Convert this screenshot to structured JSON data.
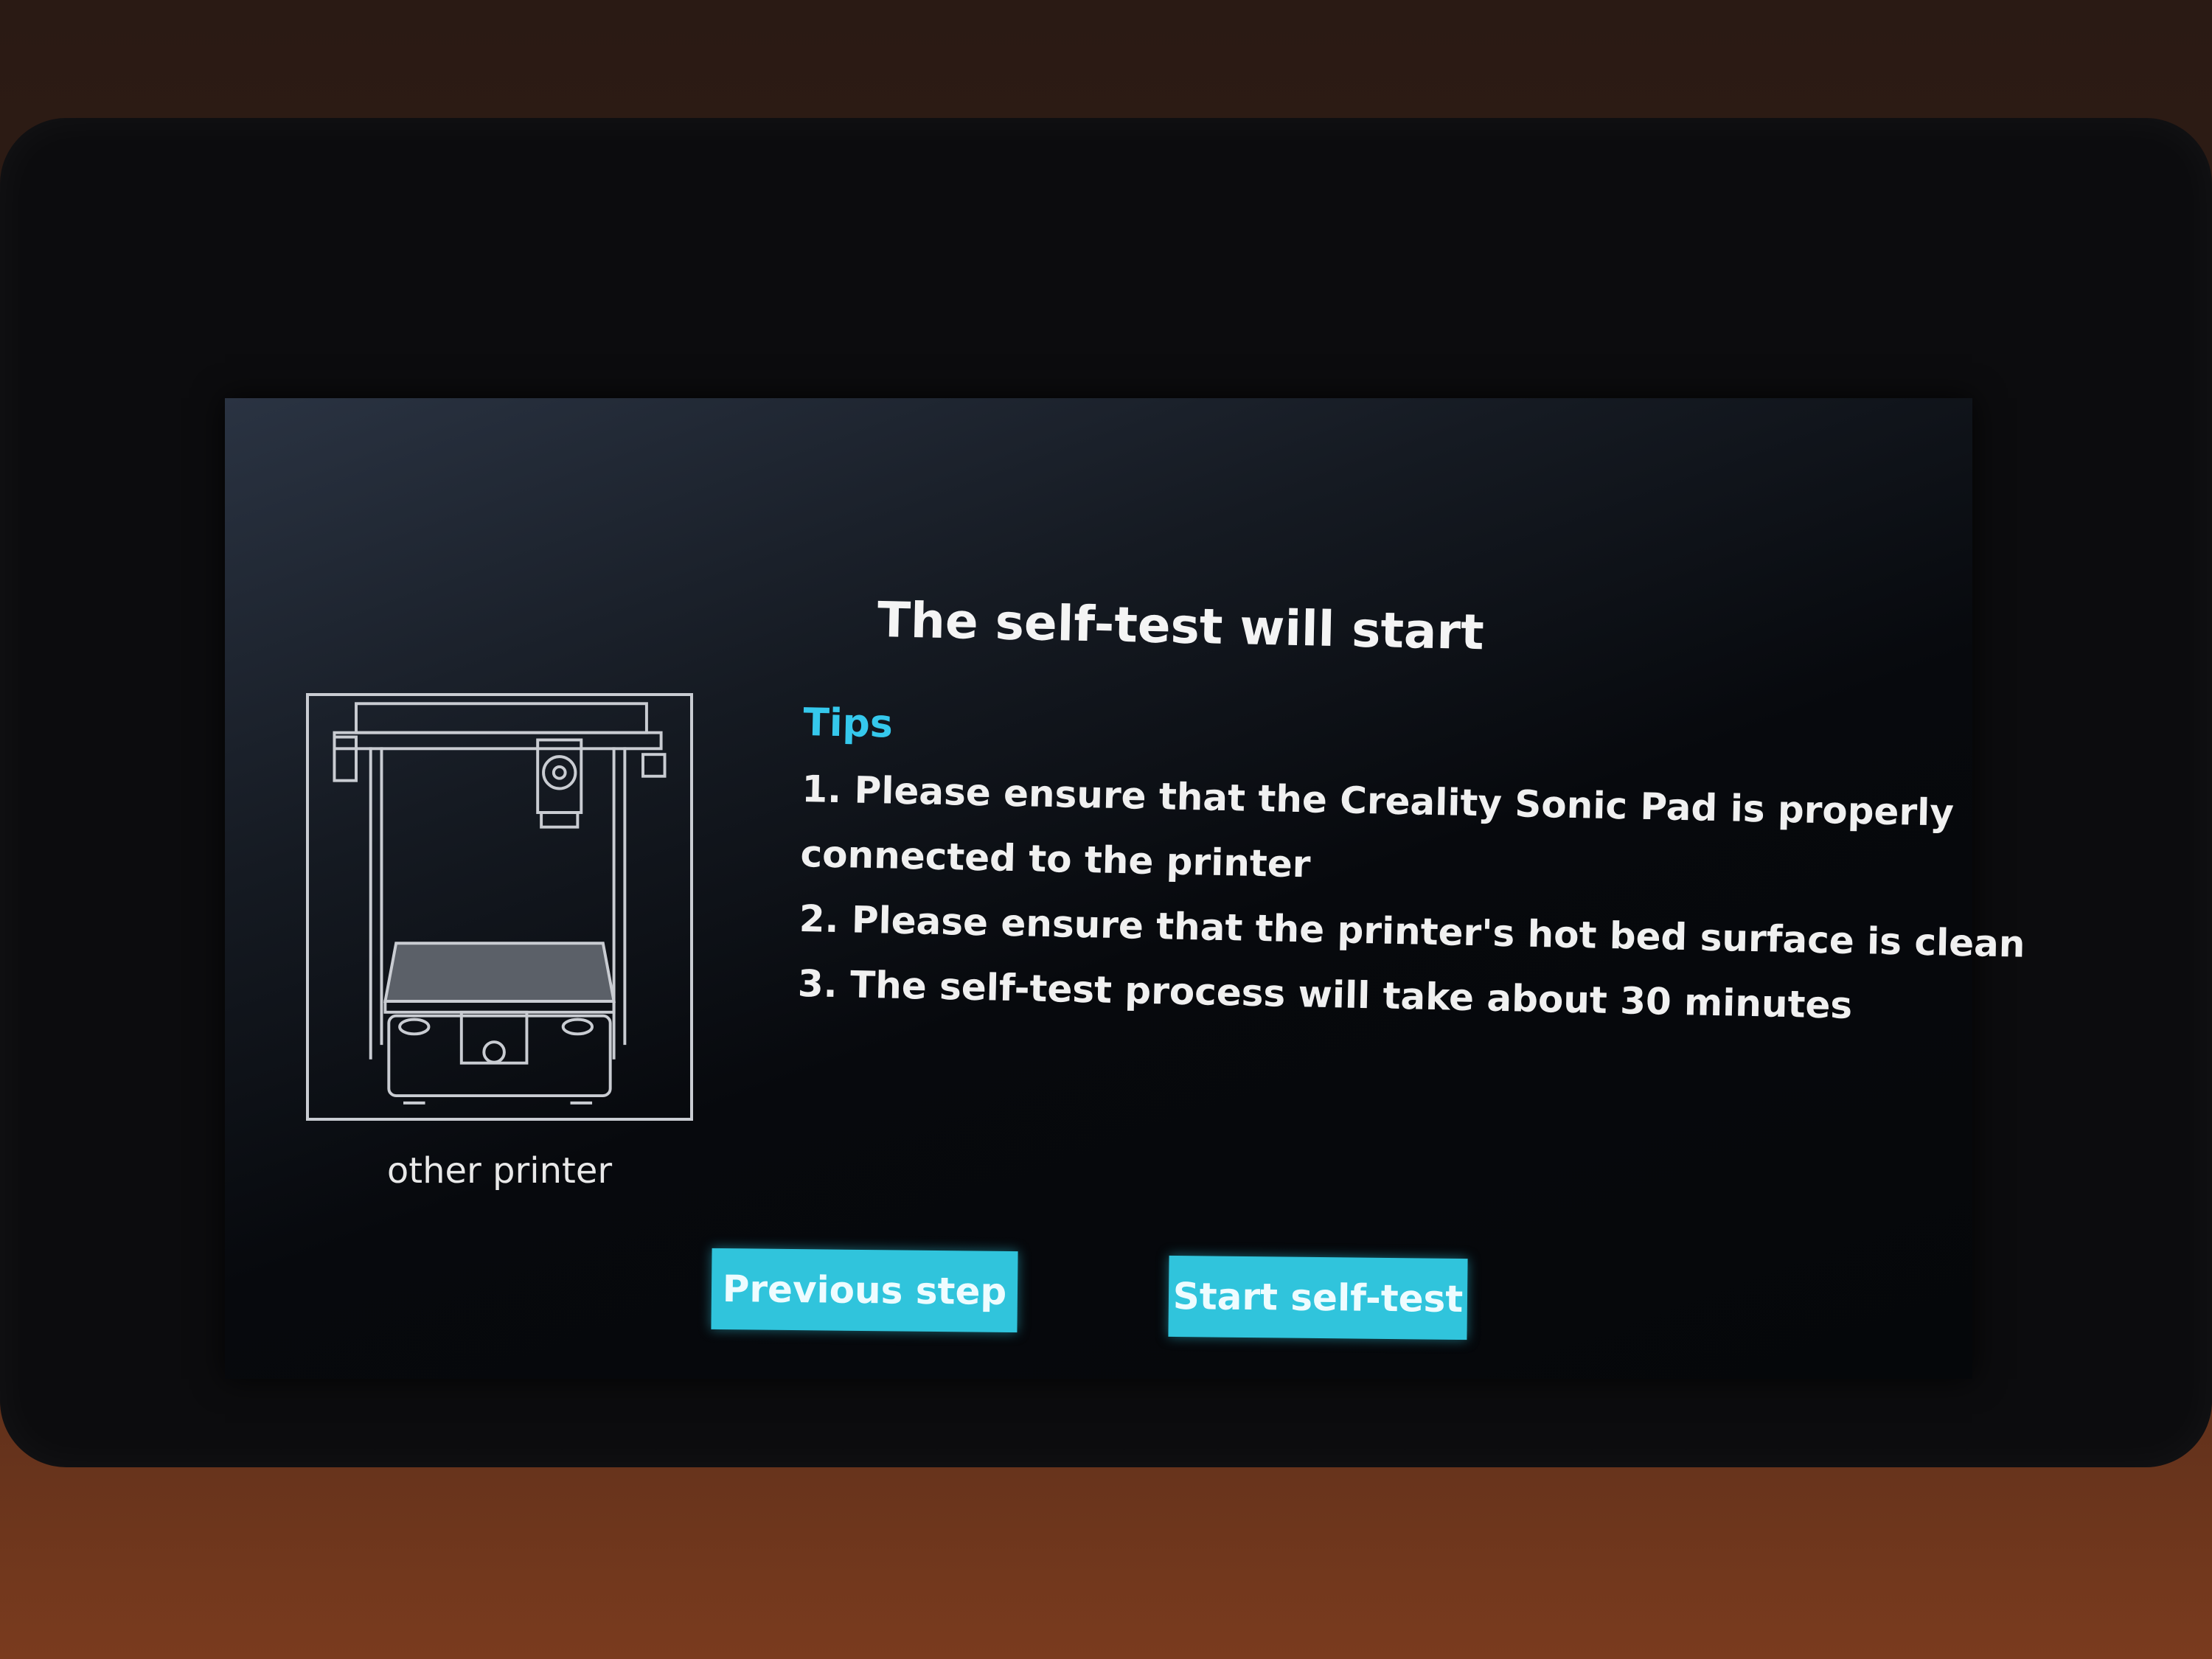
{
  "screen": {
    "title": "The self-test will start",
    "printer_caption": "other printer",
    "tips": {
      "heading": "Tips",
      "lines": [
        "1. Please ensure that the Creality Sonic Pad is properly",
        "connected to the printer",
        "2. Please ensure that the printer's hot bed surface is clean",
        "3. The self-test process will take about 30 minutes"
      ]
    },
    "buttons": {
      "previous": "Previous step",
      "start": "Start self-test"
    }
  },
  "colors": {
    "accent": "#30c4dc",
    "tips_heading": "#35c8ec",
    "text": "#f0f0f0"
  },
  "icons": {
    "printer_illustration": "3d-printer-illustration"
  }
}
